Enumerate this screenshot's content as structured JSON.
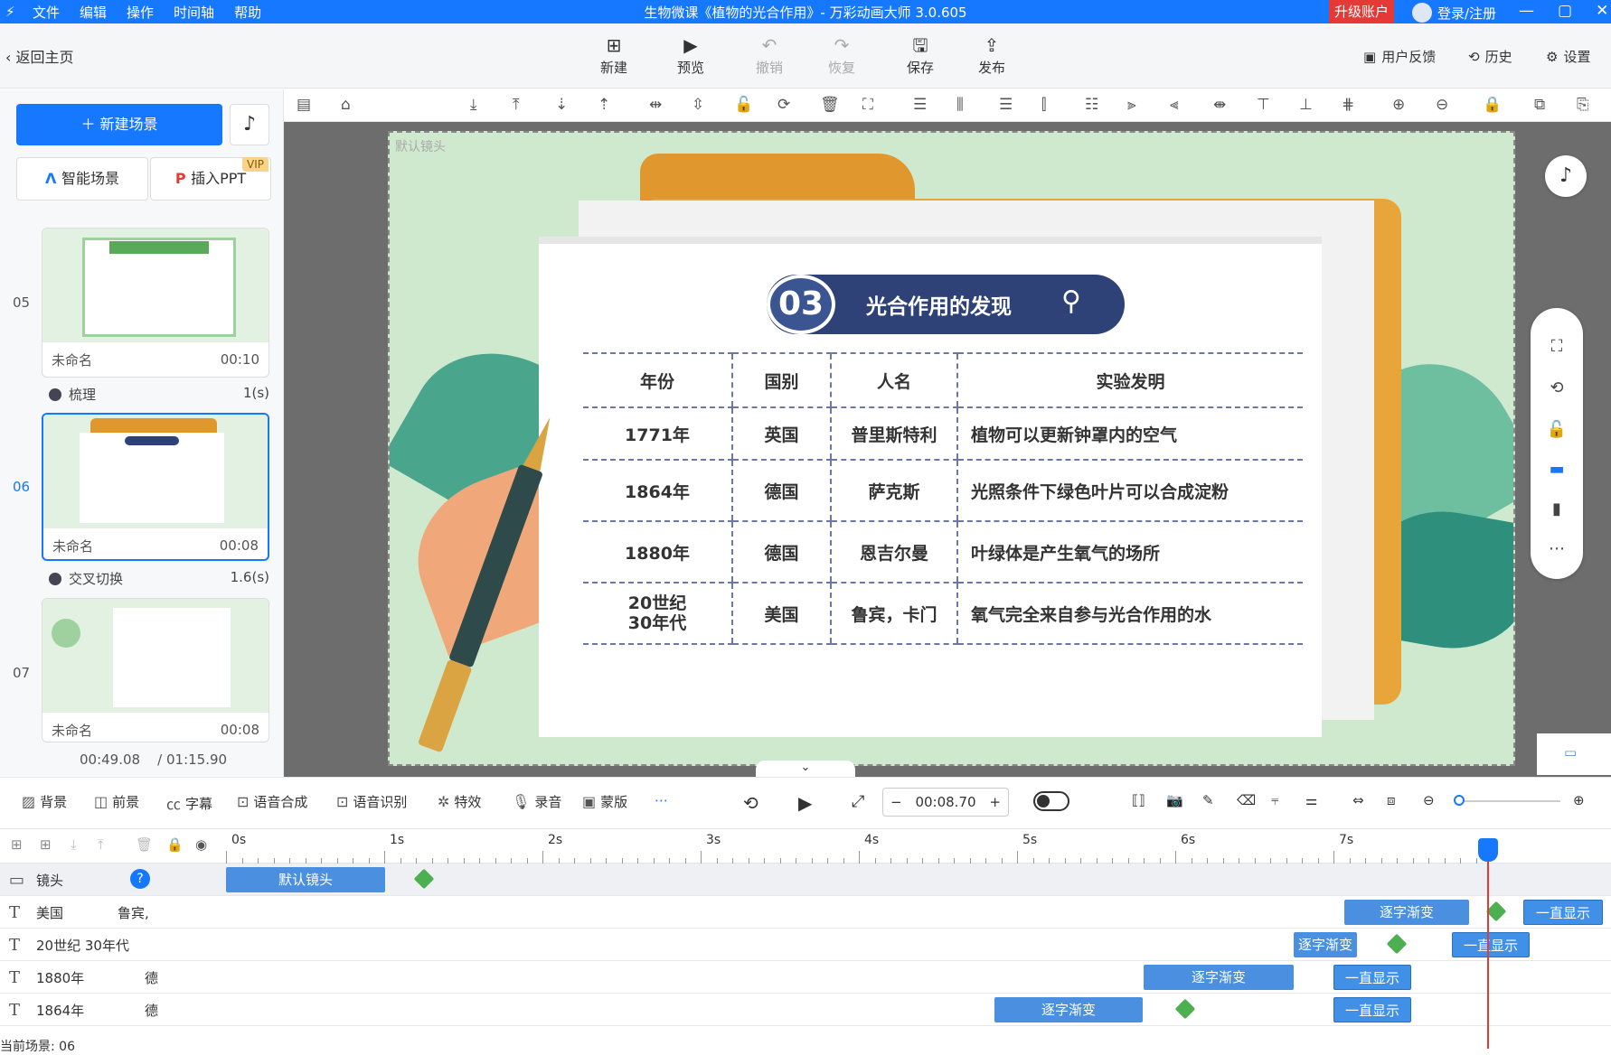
{
  "titlebar": {
    "menus": [
      "文件",
      "编辑",
      "操作",
      "时间轴",
      "帮助"
    ],
    "title": "生物微课《植物的光合作用》- 万彩动画大师 3.0.605",
    "upgrade": "升级账户",
    "login": "登录/注册",
    "controls": [
      "—",
      "▢",
      "✕"
    ]
  },
  "toolbar": {
    "back": "返回主页",
    "new": "新建",
    "preview": "预览",
    "undo": "撤销",
    "redo": "恢复",
    "save": "保存",
    "publish": "发布",
    "feedback": "用户反馈",
    "history": "历史",
    "settings": "设置"
  },
  "left": {
    "new_scene": "新建场景",
    "smart_scene": "智能场景",
    "insert_ppt": "插入PPT",
    "vip": "VIP",
    "scenes": [
      {
        "num": "05",
        "name": "未命名",
        "time": "00:10"
      },
      {
        "num": "06",
        "name": "未命名",
        "time": "00:08"
      },
      {
        "num": "07",
        "name": "未命名",
        "time": "00:08"
      }
    ],
    "transitions": [
      {
        "name": "梳理",
        "dur": "1(s)"
      },
      {
        "name": "交叉切换",
        "dur": "1.6(s)"
      }
    ],
    "current_time": "00:49.08",
    "total_time": "/ 01:15.90"
  },
  "stage": {
    "camera_label": "默认镜头",
    "heading_num": "03",
    "heading_text": "光合作用的发现",
    "table": {
      "headers": [
        "年份",
        "国别",
        "人名",
        "实验发明"
      ],
      "rows": [
        [
          "1771年",
          "英国",
          "普里斯特利",
          "植物可以更新钟罩内的空气"
        ],
        [
          "1864年",
          "德国",
          "萨克斯",
          "光照条件下绿色叶片可以合成淀粉"
        ],
        [
          "1880年",
          "德国",
          "恩吉尔曼",
          "叶绿体是产生氧气的场所"
        ],
        [
          "20世纪\n30年代",
          "美国",
          "鲁宾，卡门",
          "氧气完全来自参与光合作用的水"
        ]
      ]
    }
  },
  "bottombar": {
    "items": [
      "背景",
      "前景",
      "字幕",
      "语音合成",
      "语音识别",
      "特效",
      "录音",
      "蒙版"
    ],
    "time": "00:08.70",
    "minus": "−",
    "plus": "+"
  },
  "timeline": {
    "ticks": [
      "0s",
      "1s",
      "2s",
      "3s",
      "4s",
      "5s",
      "6s",
      "7s"
    ],
    "tracks": [
      {
        "name": "镜头",
        "sub": ""
      },
      {
        "name": "美国",
        "sub": "鲁宾,"
      },
      {
        "name": "20世纪 30年代",
        "sub": ""
      },
      {
        "name": "1880年",
        "sub": "德"
      },
      {
        "name": "1864年",
        "sub": "德"
      }
    ],
    "clip_camera": "默认镜头",
    "fade": "逐字渐变",
    "always": "一直显示",
    "current_scene": "当前场景: 06"
  }
}
